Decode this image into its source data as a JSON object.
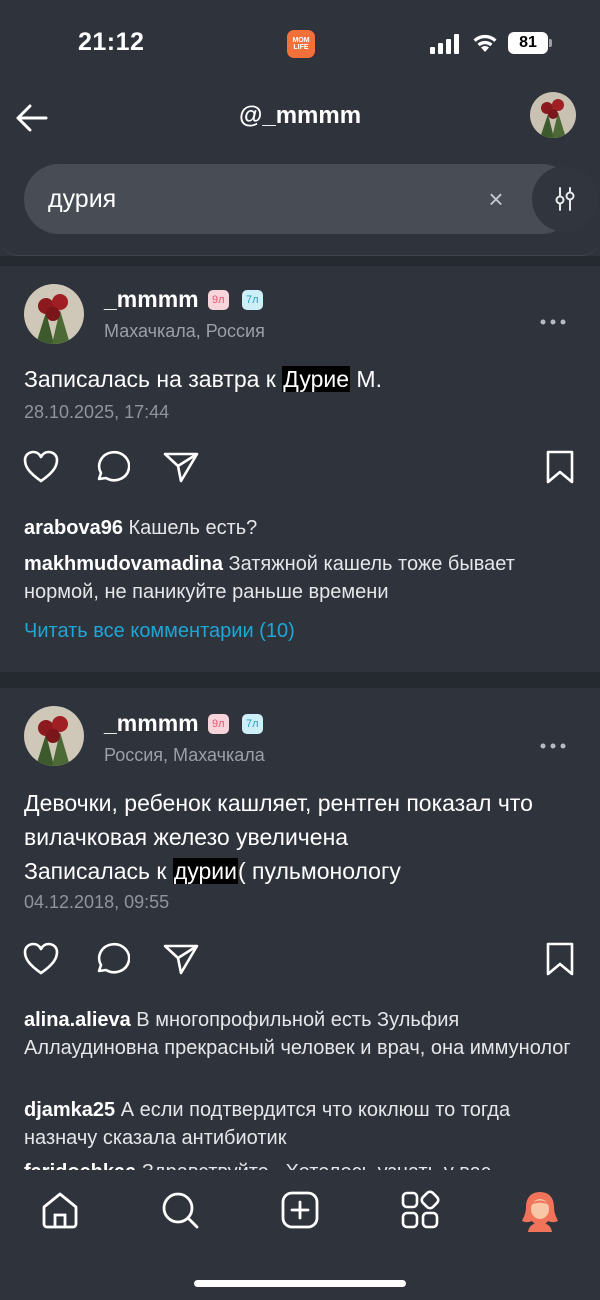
{
  "status_bar": {
    "time": "21:12",
    "app_badge": "MOM LIFE",
    "battery": "81"
  },
  "header": {
    "title": "@_mmmm",
    "back_icon": "arrow-left-icon"
  },
  "search": {
    "value": "дурия",
    "clear_icon": "close-icon",
    "filter_icon": "filter-sliders-icon"
  },
  "posts": [
    {
      "username": "_mmmm",
      "badge1": "9л",
      "badge2": "7л",
      "location": "Махачкала, Россия",
      "text_before": "Записалась на завтра к ",
      "text_highlight": "Дурие",
      "text_after": " М.",
      "date": "28.10.2025, 17:44",
      "comments": [
        {
          "user": "arabova96",
          "text": " Кашель есть?"
        },
        {
          "user": "makhmudovamadina",
          "text": " Затяжной кашель тоже бывает нормой, не паникуйте раньше времени"
        }
      ],
      "read_all": "Читать все комментарии (10)"
    },
    {
      "username": "_mmmm",
      "badge1": "9л",
      "badge2": "7л",
      "location": "Россия, Махачкала",
      "text_line1": "Девочки, ребенок кашляет, рентген показал что вилачковая железо увеличена",
      "text_before": " Записалась к ",
      "text_highlight": "дурии",
      "text_after": "( пульмонологу",
      "date": "04.12.2018, 09:55",
      "comments": [
        {
          "user": "alina.alieva",
          "text": " В многопрофильной есть Зульфия Аллаудиновна прекрасный человек и врач, она иммунолог"
        },
        {
          "user": "djamka25",
          "text": " А если подтвердится что коклюш то тогда назначу сказала антибиотик"
        },
        {
          "user": "faridochkaa",
          "text": " Здравствуйте . Хотелось узнать у вас"
        }
      ]
    }
  ],
  "nav": {
    "items": [
      "home-icon",
      "search-icon",
      "add-post-icon",
      "apps-grid-icon",
      "profile-avatar-icon"
    ]
  },
  "colors": {
    "background": "#2f333c",
    "link": "#1ea6d6",
    "badge_pink": "#f7d4da",
    "badge_blue": "#cdeff7",
    "app_badge": "#f2703a"
  }
}
